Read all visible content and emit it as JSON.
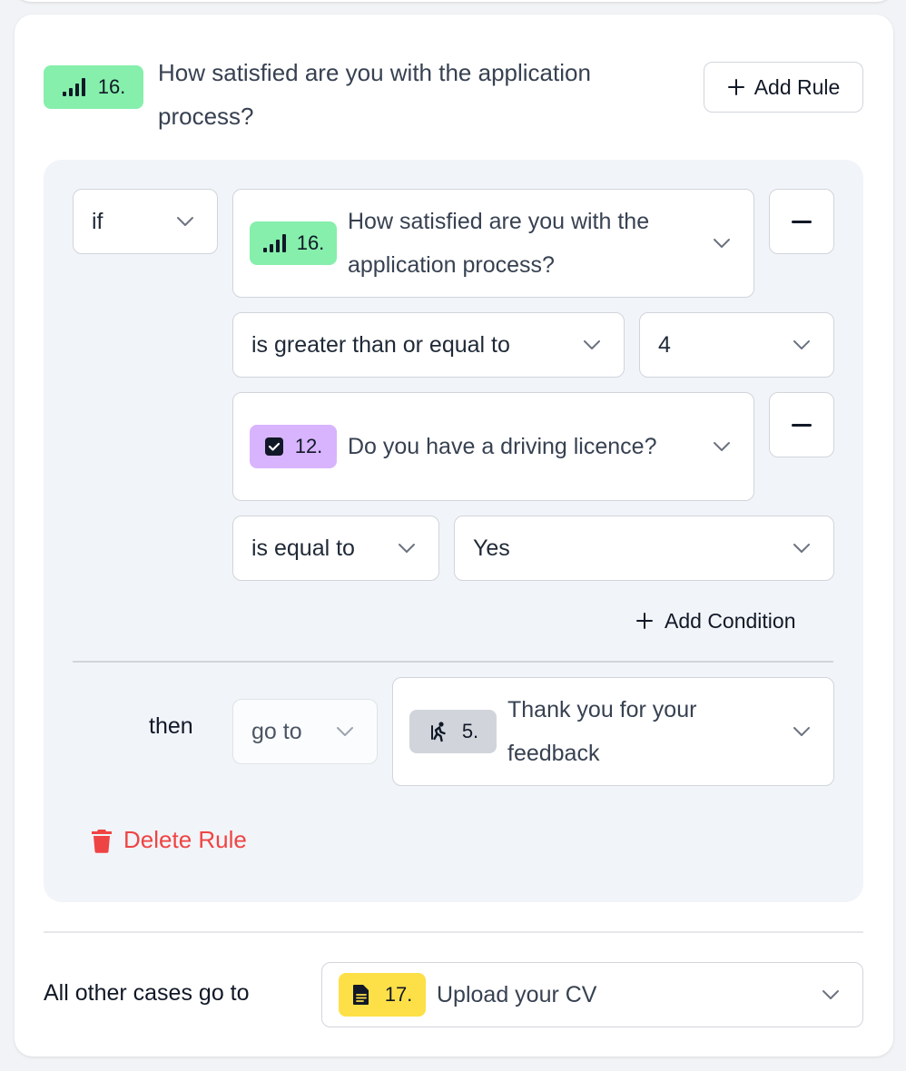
{
  "rule": {
    "question": {
      "number": "16.",
      "title": "How satisfied are you with the application process?",
      "icon": "rating-bars-icon",
      "badge_color": "#86efac"
    },
    "add_rule_label": "Add Rule",
    "logic_operator": "if",
    "conditions": [
      {
        "question_number": "16.",
        "question_title": "How satisfied are you with the application process?",
        "question_icon": "rating-bars-icon",
        "operator": "is greater than or equal to",
        "value": "4"
      },
      {
        "question_number": "12.",
        "question_title": "Do you have a driving licence?",
        "question_icon": "checkbox-icon",
        "operator": "is equal to",
        "value": "Yes"
      }
    ],
    "add_condition_label": "Add Condition",
    "then_label": "then",
    "action": "go to",
    "target": {
      "number": "5.",
      "title": "Thank you for your feedback",
      "icon": "running-person-icon"
    },
    "delete_rule_label": "Delete Rule"
  },
  "fallback": {
    "label": "All other cases go to",
    "number": "17.",
    "title": "Upload your CV",
    "icon": "file-icon"
  },
  "colors": {
    "rating_badge": "#86efac",
    "checkbox_badge": "#d8b4fe",
    "ending_badge": "#d1d5db",
    "file_badge": "#fde047",
    "danger": "#ef4444"
  }
}
